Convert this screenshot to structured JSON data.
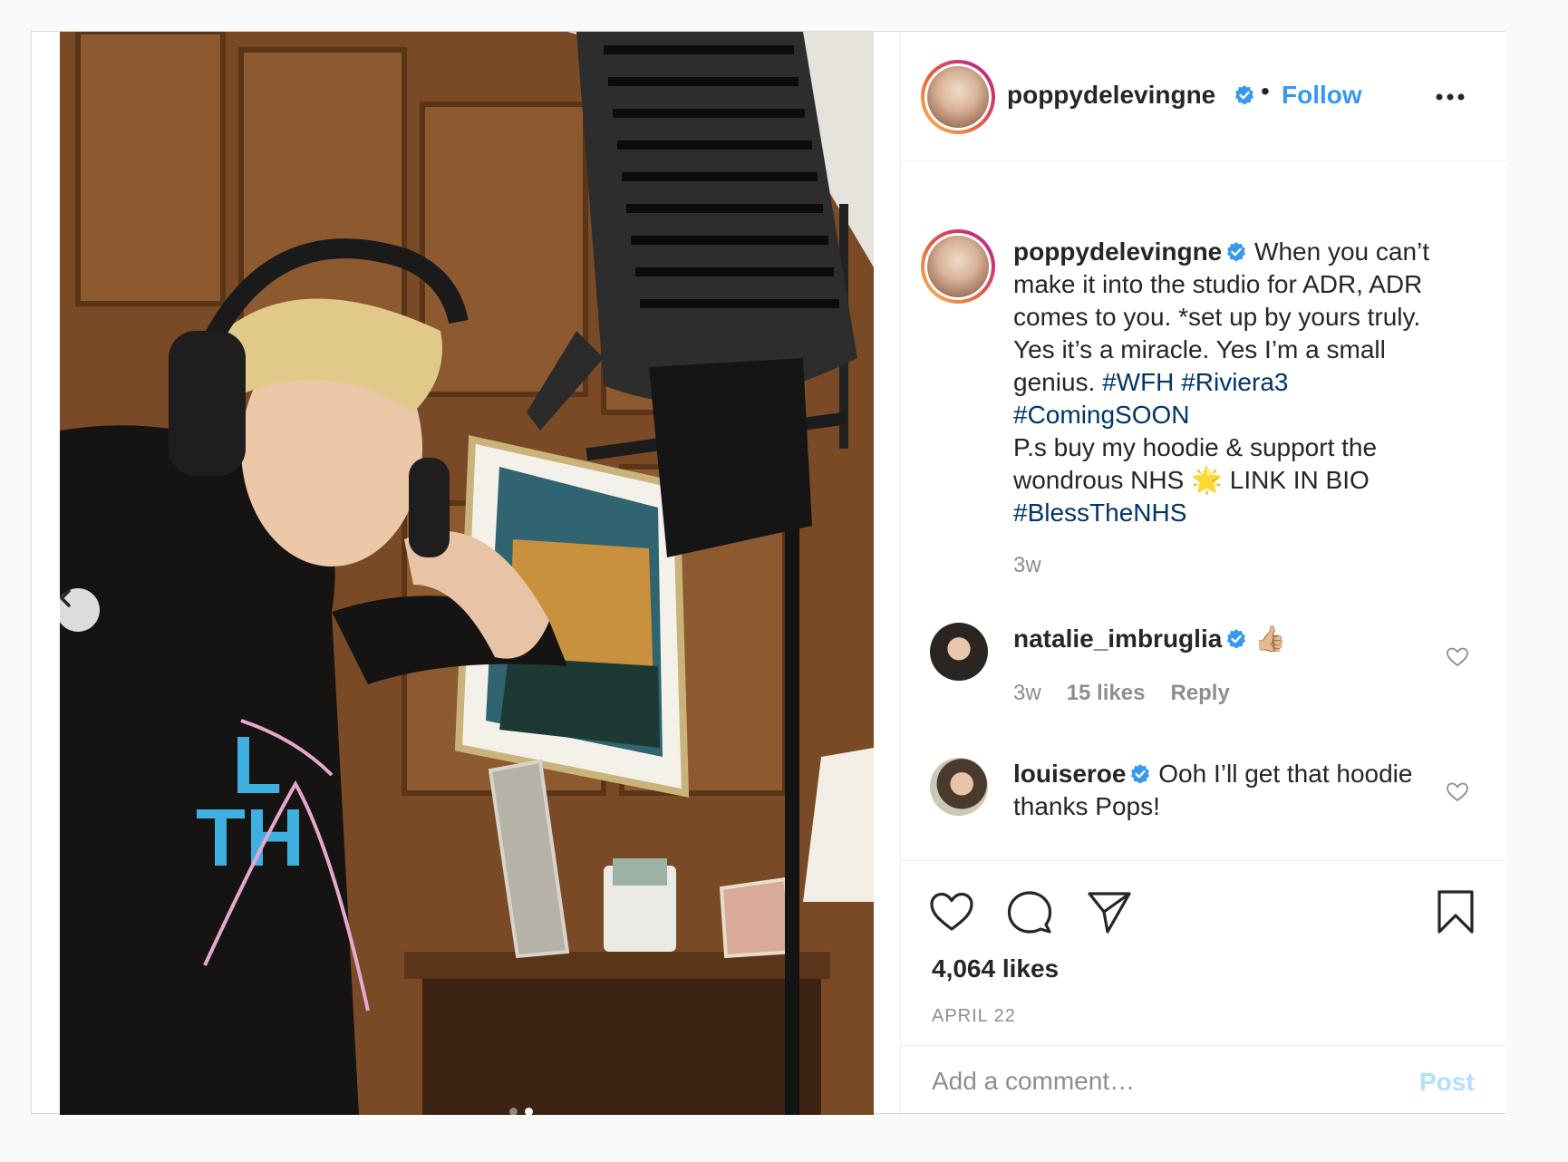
{
  "post": {
    "author": {
      "username": "poppydelevingne",
      "verified": true,
      "follow_label": "Follow",
      "separator": "•"
    },
    "caption": {
      "parts": [
        "When you can’t make it into the studio for ADR, ADR comes to you. *set up by yours truly. Yes it’s a miracle. Yes I’m a small genius. ",
        "#WFH",
        "#Riviera3",
        "#ComingSOON",
        "P.s buy my hoodie & support the wondrous NHS ",
        "🌟",
        " LINK IN BIO",
        "#BlessTheNHS"
      ],
      "time": "3w"
    },
    "comments": [
      {
        "username": "natalie_imbruglia",
        "verified": true,
        "text": "👍🏼",
        "time": "3w",
        "likes": "15 likes",
        "reply_label": "Reply"
      },
      {
        "username": "louiseroe",
        "verified": true,
        "text": "Ooh I’ll get that hoodie thanks Pops!"
      }
    ],
    "likes": "4,064 likes",
    "date": "APRIL 22",
    "add_comment_placeholder": "Add a comment…",
    "post_label": "Post",
    "carousel": {
      "total": 2,
      "current": 2
    }
  },
  "colors": {
    "link": "#3897f0",
    "hashtag": "#003569",
    "muted": "#8e8e8e",
    "text": "#262626",
    "post_disabled": "#b2dffc"
  },
  "icons": {
    "verified": "verified-badge-icon",
    "more": "more-options-icon",
    "prev": "chevron-left-icon",
    "like": "heart-icon",
    "comment": "speech-bubble-icon",
    "share": "paper-plane-icon",
    "save": "bookmark-icon"
  }
}
